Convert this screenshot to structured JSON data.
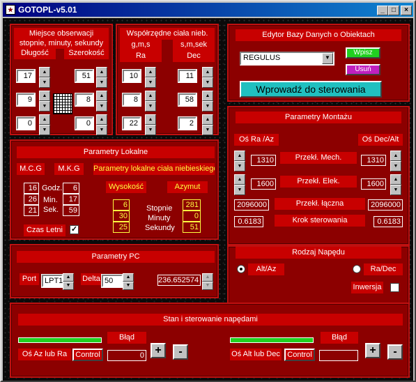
{
  "window": {
    "title": "GOTOPL-v5.01",
    "min": "_",
    "max": "□",
    "close": "×"
  },
  "obs": {
    "title1": "Miejsce obserwacji",
    "title2": "stopnie, minuty, sekundy",
    "dlugosc": "Długość",
    "szerokosc": "Szerokość",
    "d1": "17",
    "d2": "9",
    "d3": "0",
    "s1": "51",
    "s2": "8",
    "s3": "0"
  },
  "coords": {
    "title": "Współrzędne ciała nieb.",
    "gms": "g,m,s",
    "smsek": "s,m,sek",
    "ra": "Ra",
    "dec": "Dec",
    "ra1": "10",
    "ra2": "8",
    "ra3": "22",
    "dec1": "11",
    "dec2": "58",
    "dec3": "2"
  },
  "editor": {
    "title": "Edytor Bazy Danych o Obiektach",
    "object": "REGULUS",
    "add": "Wpisz",
    "remove": "Usuń",
    "apply": "Wprowadź do sterowania"
  },
  "mount": {
    "title": "Parametry Montażu",
    "ra_az": "Oś Ra /Az",
    "dec_alt": "Oś Dec/Alt",
    "mech_label": "Przekł. Mech.",
    "elek_label": "Przekł. Elek.",
    "total_label": "Przekł. łączna",
    "step_label": "Krok sterowania",
    "mech_ra": "1310",
    "mech_dec": "1310",
    "elek_ra": "1600",
    "elek_dec": "1600",
    "total_ra": "2096000",
    "total_dec": "2096000",
    "step_ra": "0.6183",
    "step_dec": "0.6183"
  },
  "drive": {
    "title": "Rodzaj Napędu",
    "altaz": "Alt/Az",
    "radec": "Ra/Dec",
    "inversion": "Inwersja"
  },
  "local": {
    "title": "Parametry Lokalne",
    "mcg": "M.C.G",
    "mkg": "M.K.G",
    "params": "Parametry lokalne ciała niebieskiego",
    "godz": "Godz.",
    "min": "Min.",
    "sek": "Sek.",
    "mcg_h": "16",
    "mcg_m": "26",
    "mcg_s": "21",
    "mkg_h": "6",
    "mkg_m": "17",
    "mkg_s": "59",
    "wys": "Wysokość",
    "azym": "Azymut",
    "stopnie": "Stopnie",
    "minuty": "Minuty",
    "sekundy": "Sekundy",
    "wys_d": "6",
    "wys_m": "30",
    "wys_s": "25",
    "az_d": "281",
    "az_m": "0",
    "az_s": "51",
    "dst": "Czas Letni"
  },
  "pc": {
    "title": "Parametry PC",
    "port": "Port",
    "port_val": "LPT1",
    "delta": "Delta",
    "delta_val": "50",
    "readout": "236.652574"
  },
  "control": {
    "title": "Stan i sterowanie napędami",
    "error": "Błąd",
    "az_label": "Oś Az lub Ra",
    "alt_label": "Oś Alt lub Dec",
    "control": "Control",
    "az_val": "0",
    "plus": "+",
    "minus": "-"
  },
  "colors": {
    "panel": "#8c0000",
    "label": "#c80000",
    "accent_cyan": "#20c0c0",
    "accent_green": "#20d020",
    "accent_magenta": "#c020c0"
  }
}
